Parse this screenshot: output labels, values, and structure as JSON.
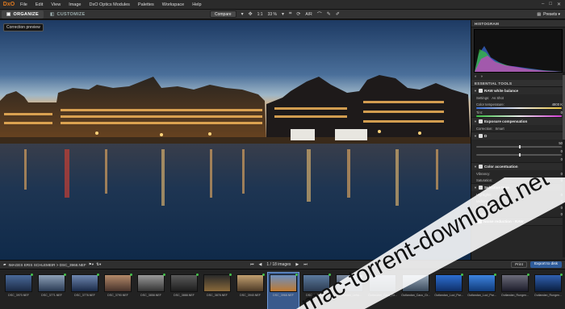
{
  "app": {
    "logo": "DxO"
  },
  "menu": [
    "File",
    "Edit",
    "View",
    "Image",
    "DxO Optics Modules",
    "Palettes",
    "Workspace",
    "Help"
  ],
  "window_controls": [
    "–",
    "□",
    "✕"
  ],
  "tabs": {
    "organize": "ORGANIZE",
    "customize": "CUSTOMIZE"
  },
  "toolbar": {
    "compare": "Compare",
    "zoom_fit": "1:1",
    "zoom_value": "33 %",
    "auto_label": "A/R"
  },
  "presets": "Presets ▾",
  "viewer": {
    "correction_preview": "Correction preview"
  },
  "panel": {
    "histogram_title": "HISTOGRAM",
    "tools_title": "ESSENTIAL TOOLS",
    "white_balance": {
      "title": "RAW white balance",
      "settings_label": "Settings:",
      "settings_value": "As Shot",
      "temp_label": "Color temperature:",
      "temp_value": "4800 K",
      "tint_label": "Tint:",
      "tint_value": "0"
    },
    "exposure": {
      "title": "Exposure compensation",
      "correction_label": "Correction:",
      "correction_value": "Smart"
    },
    "dxo_lighting": {
      "title": "D",
      "val1": "50",
      "val2": "0",
      "val3": "0"
    },
    "color_accentuation": {
      "title": "Color accentuation",
      "vibrancy_label": "Vibrancy:",
      "vibrancy_value": "0",
      "saturation_label": "Saturation:",
      "saturation_value": "0"
    },
    "selective_tone": {
      "title": "Selective tone",
      "highlights_label": "Highlights:",
      "highlights_value": "0",
      "midtones_label": "Midtones:",
      "midtones_value": "0",
      "shadows_label": "Shadows:",
      "shadows_value": "0",
      "blacks_label": "Blacks:",
      "blacks_value": "0"
    },
    "noise": {
      "title": "Noise reduction - RAW"
    }
  },
  "browser": {
    "path": "IMAGES ERIS SCHLEMEIR > DSC_3968.NEF",
    "counter": "1 / 18 images",
    "print": "Print",
    "export": "Export to disk"
  },
  "thumbnails": [
    "DSC_3970.NEF",
    "DSC_3771.NEF",
    "DSC_3778.NEF",
    "DSC_3790.NEF",
    "DSC_3858.NEF",
    "DSC_3888.NEF",
    "DSC_3878.NEF",
    "DSC_3940.NEF",
    "DSC_3968.NEF",
    "DSC_3966.NEF",
    "Outlandan_Leha...",
    "Outlandan_Cacu_Gr...",
    "Outlandan_Cacu_Gr...",
    "Outlandan_Luci_Par...",
    "Outlandan_Luci_Par...",
    "Outlandan_Rungen...",
    "Outlandan_Rungen..."
  ],
  "watermark": "mac-torrent-download.net"
}
